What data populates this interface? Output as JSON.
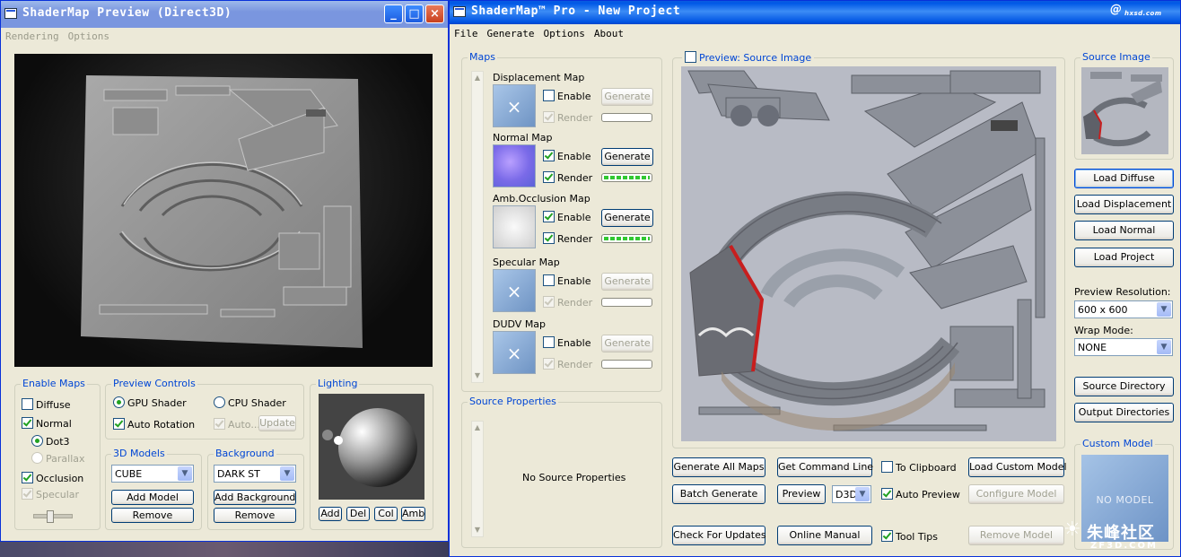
{
  "preview_window": {
    "title": "ShaderMap Preview (Direct3D)",
    "menu": [
      "Rendering",
      "Options"
    ],
    "enable_maps": {
      "legend": "Enable Maps",
      "diffuse": "Diffuse",
      "normal": "Normal",
      "dot3": "Dot3",
      "parallax": "Parallax",
      "occlusion": "Occlusion",
      "specular": "Specular"
    },
    "preview_controls": {
      "legend": "Preview Controls",
      "gpu": "GPU Shader",
      "cpu": "CPU Shader",
      "auto_rotation": "Auto Rotation",
      "auto": "Auto...",
      "update": "Update"
    },
    "models": {
      "legend": "3D Models",
      "value": "CUBE",
      "add": "Add Model",
      "remove": "Remove"
    },
    "background": {
      "legend": "Background",
      "value": "DARK ST",
      "add": "Add Background",
      "remove": "Remove"
    },
    "lighting": {
      "legend": "Lighting",
      "add": "Add",
      "del": "Del",
      "col": "Col",
      "amb": "Amb"
    }
  },
  "main_window": {
    "title": "ShaderMap™ Pro - New Project",
    "menu": [
      "File",
      "Generate",
      "Options",
      "About"
    ],
    "maps_legend": "Maps",
    "enable_label": "Enable",
    "render_label": "Render",
    "generate_label": "Generate",
    "maps": [
      {
        "name": "Displacement Map",
        "enabled": false,
        "render": true,
        "active": false,
        "progress": 0
      },
      {
        "name": "Normal Map",
        "enabled": true,
        "render": true,
        "active": true,
        "progress": 1.0
      },
      {
        "name": "Amb.Occlusion Map",
        "enabled": true,
        "render": true,
        "active": true,
        "progress": 1.0
      },
      {
        "name": "Specular Map",
        "enabled": false,
        "render": true,
        "active": false,
        "progress": 0
      },
      {
        "name": "DUDV Map",
        "enabled": false,
        "render": true,
        "active": false,
        "progress": 0
      }
    ],
    "source_properties": {
      "legend": "Source Properties",
      "empty": "No Source Properties"
    },
    "preview": {
      "label": "Preview: Source Image"
    },
    "bottom": {
      "generate_all": "Generate All Maps",
      "get_command": "Get Command Line",
      "to_clipboard": "To Clipboard",
      "load_custom": "Load Custom Model",
      "batch": "Batch Generate",
      "preview": "Preview",
      "renderer": "D3D",
      "auto_preview": "Auto Preview",
      "configure": "Configure Model",
      "check_updates": "Check For Updates",
      "online_manual": "Online Manual",
      "tool_tips": "Tool Tips",
      "remove_model": "Remove Model"
    },
    "right": {
      "source_image": "Source Image",
      "load_diffuse": "Load Diffuse",
      "load_displacement": "Load Displacement",
      "load_normal": "Load Normal",
      "load_project": "Load Project",
      "preview_res_label": "Preview Resolution:",
      "preview_res": "600 x 600",
      "wrap_label": "Wrap Mode:",
      "wrap": "NONE",
      "source_dir": "Source Directory",
      "output_dir": "Output Directories",
      "custom_model": "Custom Model",
      "no_model": "NO MODEL"
    }
  },
  "colors": {
    "accent": "#0046d5",
    "title_bar": "#0054e3",
    "window_bg": "#ece9d8",
    "progress": "#32c832"
  }
}
